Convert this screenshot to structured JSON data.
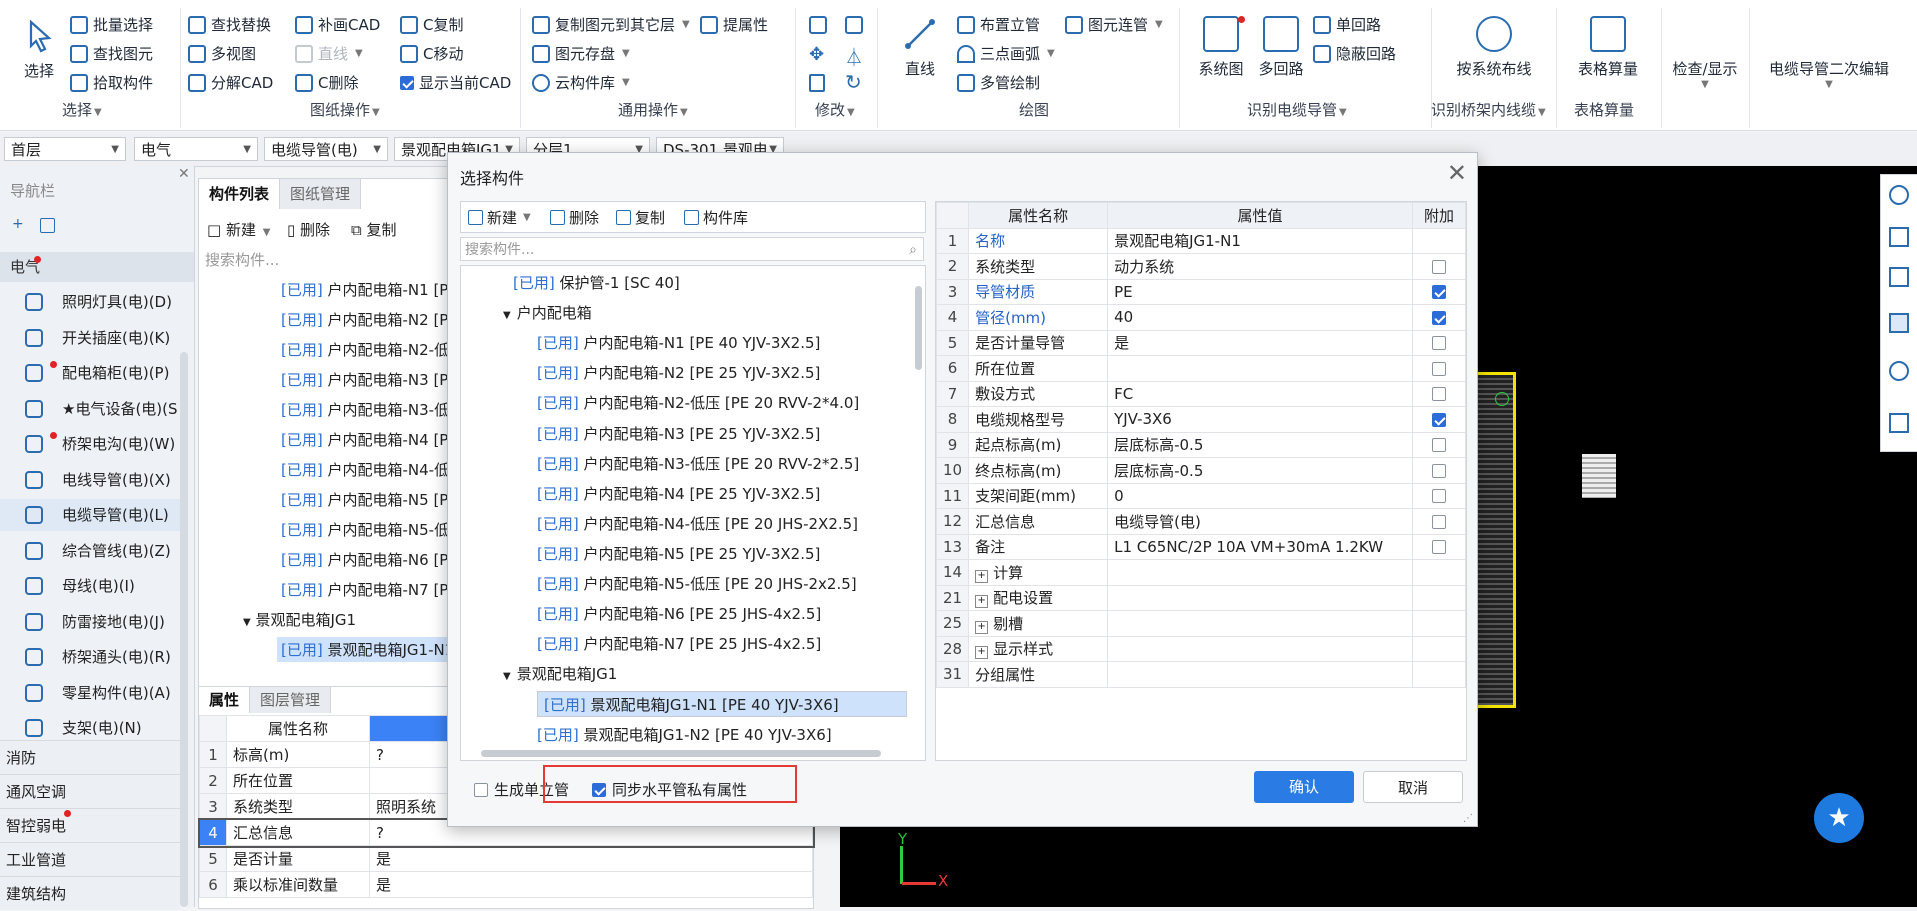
{
  "ribbon": {
    "select": {
      "big": "选择",
      "batch": "批量选择",
      "find_elem": "查找图元",
      "pick": "拾取构件",
      "group_label": "选择"
    },
    "drawing_ops": {
      "find_replace": "查找替换",
      "multi_view": "多视图",
      "decompose": "分解CAD",
      "supplement": "补画CAD",
      "line": "直线",
      "cdelete": "C删除",
      "ccopy": "C复制",
      "cmove": "C移动",
      "show_current": "显示当前CAD",
      "group_label": "图纸操作"
    },
    "general_ops": {
      "copy_to_floor": "复制图元到其它层",
      "extract_attr": "提属性",
      "elem_save": "图元存盘",
      "cloud_lib": "云构件库",
      "group_label": "通用操作"
    },
    "modify": {
      "group_label": "修改"
    },
    "draw": {
      "line": "直线",
      "place_riser": "布置立管",
      "three_arc": "三点画弧",
      "multi_pipe": "多管绘制",
      "elem_connect": "图元连管",
      "group_label": "绘图"
    },
    "identify_cable": {
      "system_map": "系统图",
      "multi_loop": "多回路",
      "single_loop": "单回路",
      "hidden_loop": "隐蔽回路",
      "group_label": "识别电缆导管"
    },
    "identify_tray": {
      "by_system": "按系统布线",
      "group_label": "识别桥架内线缆"
    },
    "table_calc": {
      "big": "表格算量",
      "group_label": "表格算量"
    },
    "check": {
      "big": "检查/显示"
    },
    "secondary": {
      "big": "电缆导管二次编辑"
    }
  },
  "selectors": {
    "floor": "首层",
    "discipline": "电气",
    "type": "电缆导管(电)",
    "component": "景观配电箱JG1",
    "layer": "分层1",
    "drawing": "DS-301 景观电"
  },
  "nav": {
    "title": "导航栏",
    "category": "电气",
    "items": [
      "照明灯具(电)(D)",
      "开关插座(电)(K)",
      "配电箱柜(电)(P)",
      "★电气设备(电)(S",
      "桥架电沟(电)(W)",
      "电线导管(电)(X)",
      "电缆导管(电)(L)",
      "综合管线(电)(Z)",
      "母线(电)(I)",
      "防雷接地(电)(J)",
      "桥架通头(电)(R)",
      "零星构件(电)(A)",
      "支架(电)(N)"
    ],
    "categories": [
      "消防",
      "通风空调",
      "智控弱电",
      "工业管道",
      "建筑结构"
    ]
  },
  "clist": {
    "tab_list": "构件列表",
    "tab_drawings": "图纸管理",
    "new": "新建",
    "delete": "删除",
    "copy": "复制",
    "search_placeholder": "搜索构件...",
    "used_tag": "[已用]",
    "rows": [
      "户内配电箱-N1 [P",
      "户内配电箱-N2 [P",
      "户内配电箱-N2-低",
      "户内配电箱-N3 [P",
      "户内配电箱-N3-低",
      "户内配电箱-N4 [P",
      "户内配电箱-N4-低",
      "户内配电箱-N5 [P",
      "户内配电箱-N5-低",
      "户内配电箱-N6 [P",
      "户内配电箱-N7 [P"
    ],
    "group": "景观配电箱JG1",
    "selected_row": "景观配电箱JG1-N1"
  },
  "props": {
    "tab_props": "属性",
    "tab_layers": "图层管理",
    "header": "属性名称",
    "rows": [
      {
        "n": "1",
        "name": "标高(m)",
        "val": "?"
      },
      {
        "n": "2",
        "name": "所在位置",
        "val": ""
      },
      {
        "n": "3",
        "name": "系统类型",
        "val": "照明系统"
      },
      {
        "n": "4",
        "name": "汇总信息",
        "val": "?"
      },
      {
        "n": "5",
        "name": "是否计量",
        "val": "是"
      },
      {
        "n": "6",
        "name": "乘以标准间数量",
        "val": "是"
      }
    ]
  },
  "dialog": {
    "title": "选择构件",
    "toolbar": {
      "new": "新建",
      "delete": "删除",
      "copy": "复制",
      "library": "构件库"
    },
    "search_placeholder": "搜索构件...",
    "used_tag": "[已用]",
    "tree": {
      "top_item": "保护管-1 [SC 40]",
      "group1": "户内配电箱",
      "group1_items": [
        "户内配电箱-N1 [PE 40 YJV-3X2.5]",
        "户内配电箱-N2 [PE 25 YJV-3X2.5]",
        "户内配电箱-N2-低压 [PE 20 RVV-2*4.0]",
        "户内配电箱-N3 [PE 25 YJV-3X2.5]",
        "户内配电箱-N3-低压 [PE 20 RVV-2*2.5]",
        "户内配电箱-N4 [PE 25 YJV-3X2.5]",
        "户内配电箱-N4-低压 [PE 20 JHS-2X2.5]",
        "户内配电箱-N5 [PE 25 YJV-3X2.5]",
        "户内配电箱-N5-低压 [PE 20 JHS-2x2.5]",
        "户内配电箱-N6 [PE 25 JHS-4x2.5]",
        "户内配电箱-N7 [PE 25 JHS-4x2.5]"
      ],
      "group2": "景观配电箱JG1",
      "group2_items": [
        "景观配电箱JG1-N1 [PE 40 YJV-3X6]",
        "景观配电箱JG1-N2 [PE 40 YJV-3X6]"
      ]
    },
    "ptable": {
      "col_name": "属性名称",
      "col_value": "属性值",
      "col_extra": "附加",
      "rows": [
        {
          "n": "1",
          "name": "名称",
          "val": "景观配电箱JG1-N1",
          "blue": true,
          "cb": null
        },
        {
          "n": "2",
          "name": "系统类型",
          "val": "动力系统",
          "blue": false,
          "cb": false
        },
        {
          "n": "3",
          "name": "导管材质",
          "val": "PE",
          "blue": true,
          "cb": true
        },
        {
          "n": "4",
          "name": "管径(mm)",
          "val": "40",
          "blue": true,
          "cb": true
        },
        {
          "n": "5",
          "name": "是否计量导管",
          "val": "是",
          "blue": false,
          "cb": false
        },
        {
          "n": "6",
          "name": "所在位置",
          "val": "",
          "blue": false,
          "cb": false
        },
        {
          "n": "7",
          "name": "敷设方式",
          "val": "FC",
          "blue": false,
          "cb": false
        },
        {
          "n": "8",
          "name": "电缆规格型号",
          "val": "YJV-3X6",
          "blue": false,
          "cb": true
        },
        {
          "n": "9",
          "name": "起点标高(m)",
          "val": "层底标高-0.5",
          "blue": false,
          "cb": false
        },
        {
          "n": "10",
          "name": "终点标高(m)",
          "val": "层底标高-0.5",
          "blue": false,
          "cb": false
        },
        {
          "n": "11",
          "name": "支架间距(mm)",
          "val": "0",
          "blue": false,
          "cb": false
        },
        {
          "n": "12",
          "name": "汇总信息",
          "val": "电缆导管(电)",
          "blue": false,
          "cb": false
        },
        {
          "n": "13",
          "name": "备注",
          "val": "L1 C65NC/2P 10A VM+30mA 1.2KW",
          "blue": false,
          "cb": false
        },
        {
          "n": "14",
          "name": "计算",
          "val": "",
          "blue": false,
          "cb": null,
          "expand": true
        },
        {
          "n": "21",
          "name": "配电设置",
          "val": "",
          "blue": false,
          "cb": null,
          "expand": true
        },
        {
          "n": "25",
          "name": "剔槽",
          "val": "",
          "blue": false,
          "cb": null,
          "expand": true
        },
        {
          "n": "28",
          "name": "显示样式",
          "val": "",
          "blue": false,
          "cb": null,
          "expand": true
        },
        {
          "n": "31",
          "name": "分组属性",
          "val": "",
          "blue": false,
          "cb": null
        }
      ]
    },
    "gen_riser": "生成单立管",
    "sync_props": "同步水平管私有属性",
    "confirm": "确认",
    "cancel": "取消"
  },
  "colors": {
    "accent": "#2b6cd6",
    "highlight": "#e53935",
    "fab": "#1f7ae0",
    "selection_box": "#f2e400"
  },
  "icons": [
    "select-icon",
    "batch-select-icon",
    "find-icon",
    "pick-icon",
    "gear-icon",
    "close-icon",
    "search-icon",
    "star-icon",
    "checkbox-icon"
  ]
}
